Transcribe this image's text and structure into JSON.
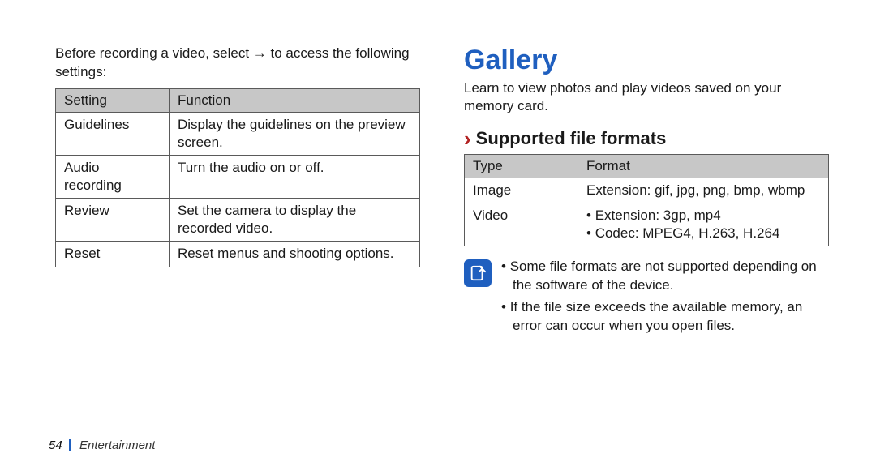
{
  "left": {
    "lead": "Before recording a video, select        →      to access the following settings:",
    "table": {
      "headers": [
        "Setting",
        "Function"
      ],
      "rows": [
        [
          "Guidelines",
          "Display the guidelines on the preview screen."
        ],
        [
          "Audio recording",
          "Turn the audio on or off."
        ],
        [
          "Review",
          "Set the camera to display the recorded video."
        ],
        [
          "Reset",
          "Reset menus and shooting options."
        ]
      ]
    }
  },
  "right": {
    "title": "Gallery",
    "subtitle": "Learn to view photos and play videos saved on your memory card.",
    "section": "Supported file formats",
    "table": {
      "headers": [
        "Type",
        "Format"
      ],
      "rows": [
        {
          "type": "Image",
          "format_plain": "Extension: gif, jpg, png, bmp, wbmp"
        },
        {
          "type": "Video",
          "format_list": [
            "Extension: 3gp, mp4",
            "Codec: MPEG4, H.263, H.264"
          ]
        }
      ]
    },
    "notes": [
      "Some file formats are not supported depending on the software of the device.",
      "If the file size exceeds the available memory, an error can occur when you open files."
    ]
  },
  "footer": {
    "page": "54",
    "section": "Entertainment"
  }
}
